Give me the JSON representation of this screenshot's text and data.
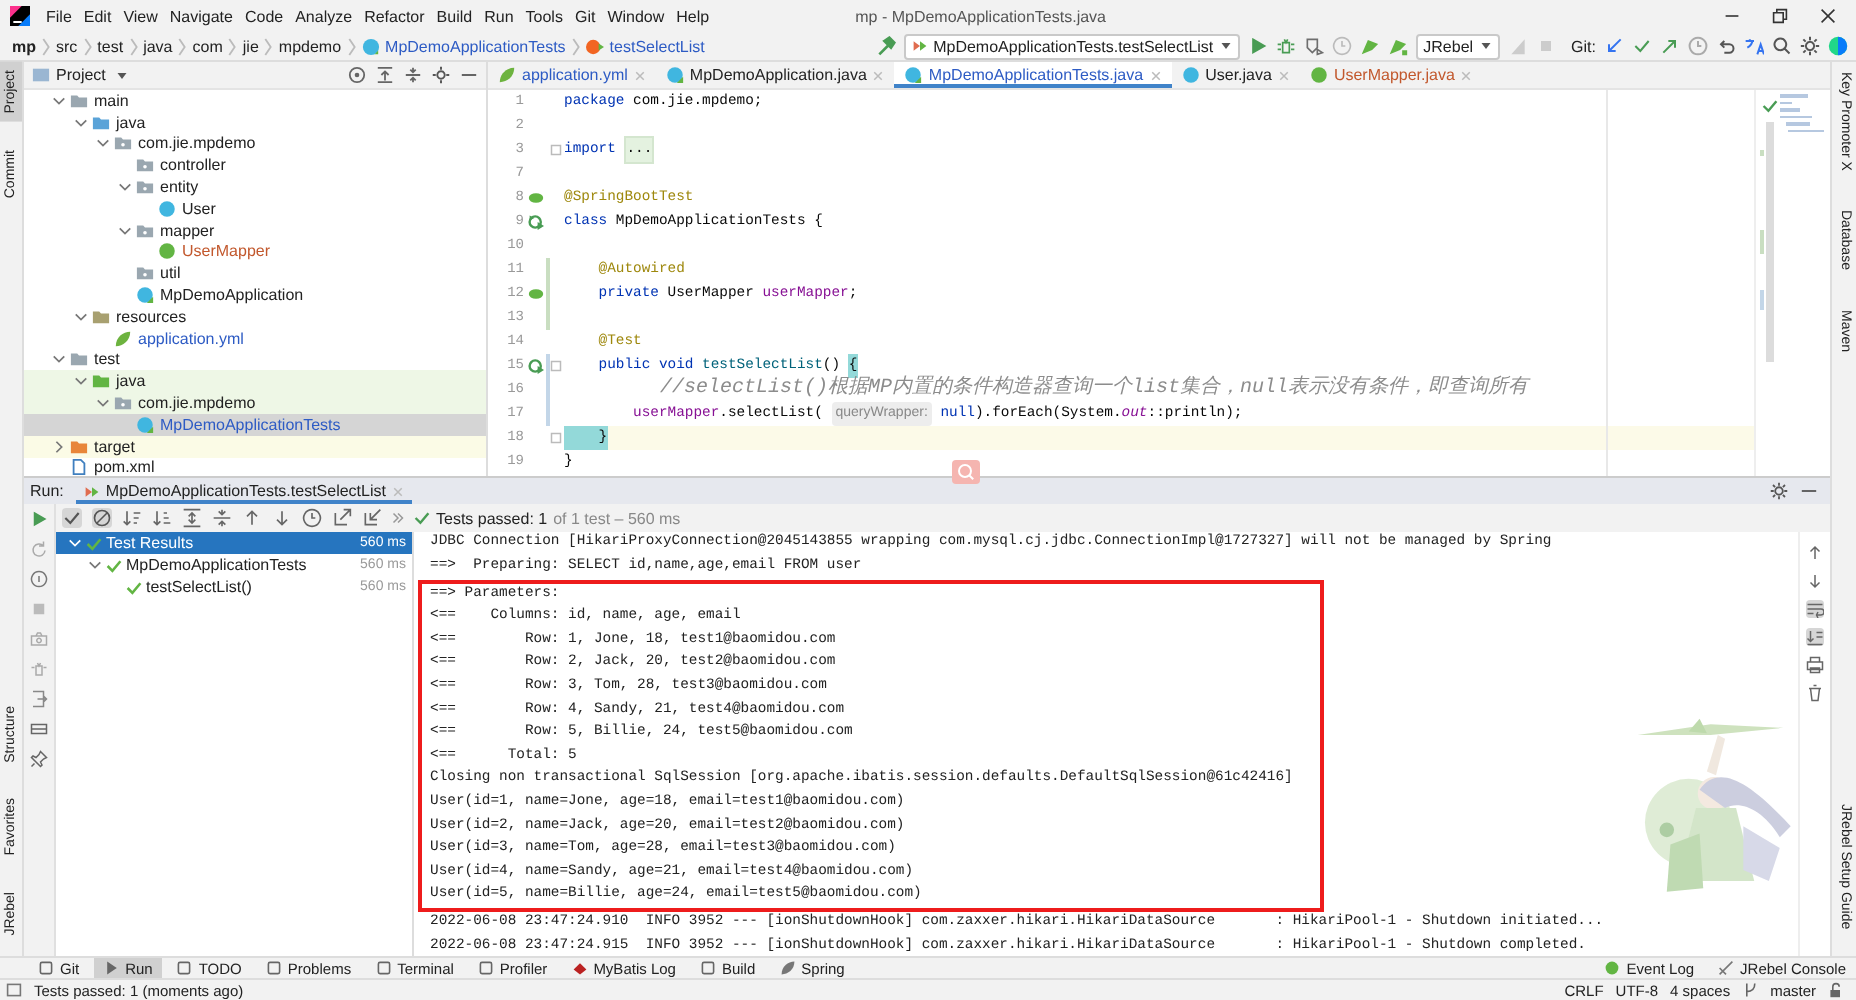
{
  "window": {
    "title": "mp - MpDemoApplicationTests.java"
  },
  "menu": [
    "File",
    "Edit",
    "View",
    "Navigate",
    "Code",
    "Analyze",
    "Refactor",
    "Build",
    "Run",
    "Tools",
    "Git",
    "Window",
    "Help"
  ],
  "breadcrumbs": [
    {
      "label": "mp",
      "kind": "project"
    },
    {
      "label": "src",
      "kind": "dir"
    },
    {
      "label": "test",
      "kind": "dir"
    },
    {
      "label": "java",
      "kind": "dir"
    },
    {
      "label": "com",
      "kind": "dir"
    },
    {
      "label": "jie",
      "kind": "dir"
    },
    {
      "label": "mpdemo",
      "kind": "dir"
    },
    {
      "label": "MpDemoApplicationTests",
      "kind": "class"
    },
    {
      "label": "testSelectList",
      "kind": "method"
    }
  ],
  "toolbar": {
    "run_config": "MpDemoApplicationTests.testSelectList",
    "jrebel": "JRebel",
    "git_label": "Git:"
  },
  "left_strip": {
    "top": [
      {
        "label": "Project",
        "selected": true
      },
      {
        "label": "Commit",
        "selected": false
      }
    ],
    "bottom": [
      {
        "label": "Structure",
        "selected": false
      },
      {
        "label": "Favorites",
        "selected": false
      },
      {
        "label": "JRebel",
        "selected": false
      }
    ]
  },
  "right_strip": {
    "top": [
      "Key Promoter X",
      "Database",
      "Maven"
    ],
    "bottom": [
      "JRebel Setup Guide"
    ]
  },
  "project": {
    "title": "Project",
    "tree": [
      {
        "name": "main",
        "kind": "folder",
        "expanded": true,
        "selected": false,
        "children": [
          {
            "name": "java",
            "kind": "source-folder",
            "expanded": true,
            "selected": false,
            "children": [
              {
                "name": "com.jie.mpdemo",
                "kind": "package",
                "expanded": true,
                "selected": false,
                "children": [
                  {
                    "name": "controller",
                    "kind": "package",
                    "selected": false
                  },
                  {
                    "name": "entity",
                    "kind": "package",
                    "expanded": true,
                    "selected": false,
                    "children": [
                      {
                        "name": "User",
                        "kind": "class",
                        "selected": false
                      }
                    ]
                  },
                  {
                    "name": "mapper",
                    "kind": "package",
                    "expanded": true,
                    "selected": false,
                    "children": [
                      {
                        "name": "UserMapper",
                        "kind": "interface",
                        "color": "#c2582d",
                        "selected": false
                      }
                    ]
                  },
                  {
                    "name": "util",
                    "kind": "package",
                    "selected": false
                  },
                  {
                    "name": "MpDemoApplication",
                    "kind": "spring-class",
                    "selected": false
                  }
                ]
              }
            ]
          },
          {
            "name": "resources",
            "kind": "resources-folder",
            "expanded": true,
            "selected": false,
            "children": [
              {
                "name": "application.yml",
                "kind": "yml",
                "color": "#2d5bc4",
                "selected": false
              }
            ]
          }
        ]
      },
      {
        "name": "test",
        "kind": "folder",
        "expanded": true,
        "selected": false,
        "children": [
          {
            "name": "java",
            "kind": "test-folder",
            "expanded": true,
            "test_source": true,
            "selected": false,
            "children": [
              {
                "name": "com.jie.mpdemo",
                "kind": "package",
                "expanded": true,
                "test_source": true,
                "selected": false,
                "children": [
                  {
                    "name": "MpDemoApplicationTests",
                    "kind": "test-class",
                    "color": "#2d5bc4",
                    "selected": true
                  }
                ]
              }
            ]
          }
        ]
      },
      {
        "name": "target",
        "kind": "excluded-folder",
        "expanded": false,
        "excluded": true,
        "selected": false
      },
      {
        "name": "pom.xml",
        "kind": "xml",
        "selected": false
      }
    ]
  },
  "editor": {
    "tabs": [
      {
        "label": "application.yml",
        "kind": "yml",
        "color": "#2d5bc4",
        "selected": false
      },
      {
        "label": "MpDemoApplication.java",
        "kind": "spring-class",
        "selected": false
      },
      {
        "label": "MpDemoApplicationTests.java",
        "kind": "test-class",
        "color": "#2d5bc4",
        "selected": true
      },
      {
        "label": "User.java",
        "kind": "class",
        "selected": false
      },
      {
        "label": "UserMapper.java",
        "kind": "interface",
        "color": "#c2582d",
        "selected": false
      }
    ],
    "lines": [
      {
        "no": "1",
        "tokens": [
          {
            "t": "package",
            "kind": "kw"
          },
          {
            "t": " com.jie.mpdemo;",
            "kind": "plain"
          }
        ]
      },
      {
        "no": "2"
      },
      {
        "no": "3",
        "fold": true,
        "tokens": [
          {
            "t": "import ",
            "kind": "kw"
          },
          {
            "t": "...",
            "kind": "folded"
          }
        ]
      },
      {
        "no": "7"
      },
      {
        "no": "8",
        "kind": "bean",
        "tokens": [
          {
            "t": "@SpringBootTest",
            "kind": "ann"
          }
        ]
      },
      {
        "no": "9",
        "kind": "run-all",
        "tokens": [
          {
            "t": "class",
            "kind": "kw"
          },
          {
            "t": " MpDemoApplicationTests ",
            "kind": "plain"
          },
          {
            "t": "{",
            "kind": "brace"
          }
        ]
      },
      {
        "no": "10"
      },
      {
        "no": "11",
        "added": true,
        "tokens": [
          {
            "t": "    @Autowired",
            "kind": "ann"
          }
        ]
      },
      {
        "no": "12",
        "added": true,
        "kind": "bean",
        "tokens": [
          {
            "t": "    private",
            "kind": "kw"
          },
          {
            "t": " UserMapper ",
            "kind": "plain"
          },
          {
            "t": "userMapper",
            "kind": "field"
          },
          {
            "t": ";",
            "kind": "plain"
          }
        ]
      },
      {
        "no": "13",
        "added": true
      },
      {
        "no": "14",
        "tokens": [
          {
            "t": "    @Test",
            "kind": "ann"
          }
        ]
      },
      {
        "no": "15",
        "modified": true,
        "kind": "run",
        "fold": true,
        "tokens": [
          {
            "t": "    public void ",
            "kind": "kw"
          },
          {
            "t": "testSelectList",
            "kind": "method"
          },
          {
            "t": "() ",
            "kind": "plain"
          },
          {
            "t": "{",
            "kind": "brace-match"
          }
        ]
      },
      {
        "no": "16",
        "modified": true,
        "tokens": [
          {
            "t": "        //selectList()根据MP内置的条件构造器查询一个list集合，null表示没有条件，即查询所有",
            "kind": "comment"
          }
        ]
      },
      {
        "no": "17",
        "modified": true,
        "tokens": [
          {
            "t": "        userMapper",
            "kind": "field"
          },
          {
            "t": ".selectList( ",
            "kind": "plain"
          },
          {
            "t": "queryWrapper:",
            "kind": "hint"
          },
          {
            "t": " null",
            "kind": "kw"
          },
          {
            "t": ").forEach(System.",
            "kind": "plain"
          },
          {
            "t": "out",
            "kind": "static"
          },
          {
            "t": "::println);",
            "kind": "plain"
          }
        ]
      },
      {
        "no": "18",
        "current": true,
        "fold": true,
        "tokens": [
          {
            "t": "    }",
            "kind": "brace-match"
          }
        ]
      },
      {
        "no": "19",
        "tokens": [
          {
            "t": "}",
            "kind": "brace"
          }
        ]
      }
    ]
  },
  "run": {
    "label": "Run:",
    "tab": "MpDemoApplicationTests.testSelectList",
    "passed": "Tests passed: 1",
    "passed_detail": "of 1 test – 560 ms",
    "tests": [
      {
        "name": "Test Results",
        "time": "560 ms",
        "selected": true,
        "expanded": true,
        "children": [
          {
            "name": "MpDemoApplicationTests",
            "time": "560 ms",
            "selected": false,
            "expanded": true,
            "children": [
              {
                "name": "testSelectList()",
                "time": "560 ms",
                "selected": false
              }
            ]
          }
        ]
      }
    ],
    "console": {
      "lines_above": [
        "JDBC Connection [HikariProxyConnection@2045143855 wrapping com.mysql.cj.jdbc.ConnectionImpl@1727327] will not be managed by Spring",
        "==>  Preparing: SELECT id,name,age,email FROM user"
      ],
      "framed_lines": [
        "==> Parameters:",
        "<==    Columns: id, name, age, email",
        "<==        Row: 1, Jone, 18, test1@baomidou.com",
        "<==        Row: 2, Jack, 20, test2@baomidou.com",
        "<==        Row: 3, Tom, 28, test3@baomidou.com",
        "<==        Row: 4, Sandy, 21, test4@baomidou.com",
        "<==        Row: 5, Billie, 24, test5@baomidou.com",
        "<==      Total: 5",
        "Closing non transactional SqlSession [org.apache.ibatis.session.defaults.DefaultSqlSession@61c42416]",
        "User(id=1, name=Jone, age=18, email=test1@baomidou.com)",
        "User(id=2, name=Jack, age=20, email=test2@baomidou.com)",
        "User(id=3, name=Tom, age=28, email=test3@baomidou.com)",
        "User(id=4, name=Sandy, age=21, email=test4@baomidou.com)",
        "User(id=5, name=Billie, age=24, email=test5@baomidou.com)"
      ],
      "lines_below": [
        "2022-06-08 23:47:24.910  INFO 3952 --- [ionShutdownHook] com.zaxxer.hikari.HikariDataSource       : HikariPool-1 - Shutdown initiated...",
        "2022-06-08 23:47:24.915  INFO 3952 --- [ionShutdownHook] com.zaxxer.hikari.HikariDataSource       : HikariPool-1 - Shutdown completed."
      ],
      "background": {
        "kind": "picture"
      }
    }
  },
  "tool_tabs": {
    "left": [
      {
        "label": "Git",
        "kind": "git",
        "selected": false
      },
      {
        "label": "Run",
        "kind": "run",
        "selected": true
      },
      {
        "label": "TODO",
        "kind": "todo",
        "selected": false
      },
      {
        "label": "Problems",
        "kind": "problems",
        "selected": false
      },
      {
        "label": "Terminal",
        "kind": "terminal",
        "selected": false
      },
      {
        "label": "Profiler",
        "kind": "profiler",
        "selected": false
      },
      {
        "label": "MyBatis Log",
        "kind": "mybatis",
        "selected": false
      },
      {
        "label": "Build",
        "kind": "build",
        "selected": false
      },
      {
        "label": "Spring",
        "kind": "spring",
        "selected": false
      }
    ],
    "right": [
      {
        "label": "Event Log",
        "kind": "event",
        "selected": false
      },
      {
        "label": "JRebel Console",
        "kind": "jrebel",
        "selected": false
      }
    ]
  },
  "status_bar": {
    "message": "Tests passed: 1 (moments ago)",
    "items": [
      "CRLF",
      "UTF-8",
      "4 spaces"
    ],
    "branch": "master"
  }
}
